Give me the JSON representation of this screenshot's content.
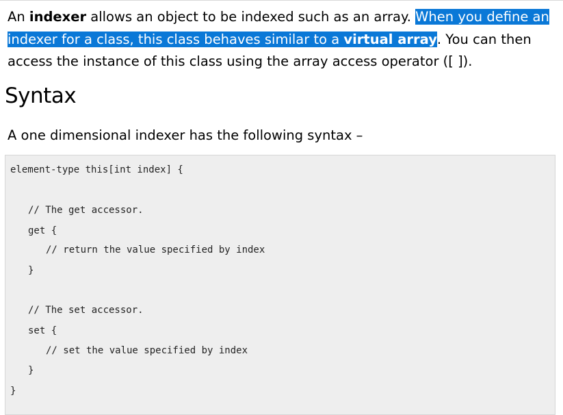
{
  "intro": {
    "part1": "An ",
    "bold1": "indexer",
    "part2": " allows an object to be indexed such as an array. ",
    "sel_part": "When you define an indexer for a class, this class behaves similar to a ",
    "sel_bold": "virtual array",
    "part3": ". You can then access the instance of this class using the array access operator ([ ])."
  },
  "section": {
    "heading": "Syntax",
    "lead": "A one dimensional indexer has the following syntax –"
  },
  "code": {
    "lines": [
      "element-type this[int index] {",
      "// The get accessor.",
      "get {",
      "// return the value specified by index",
      "}",
      "// The set accessor.",
      "set {",
      "// set the value specified by index",
      "}",
      "}"
    ]
  },
  "colors": {
    "selection": "#0a78d7",
    "code_background": "#eeeeee"
  }
}
